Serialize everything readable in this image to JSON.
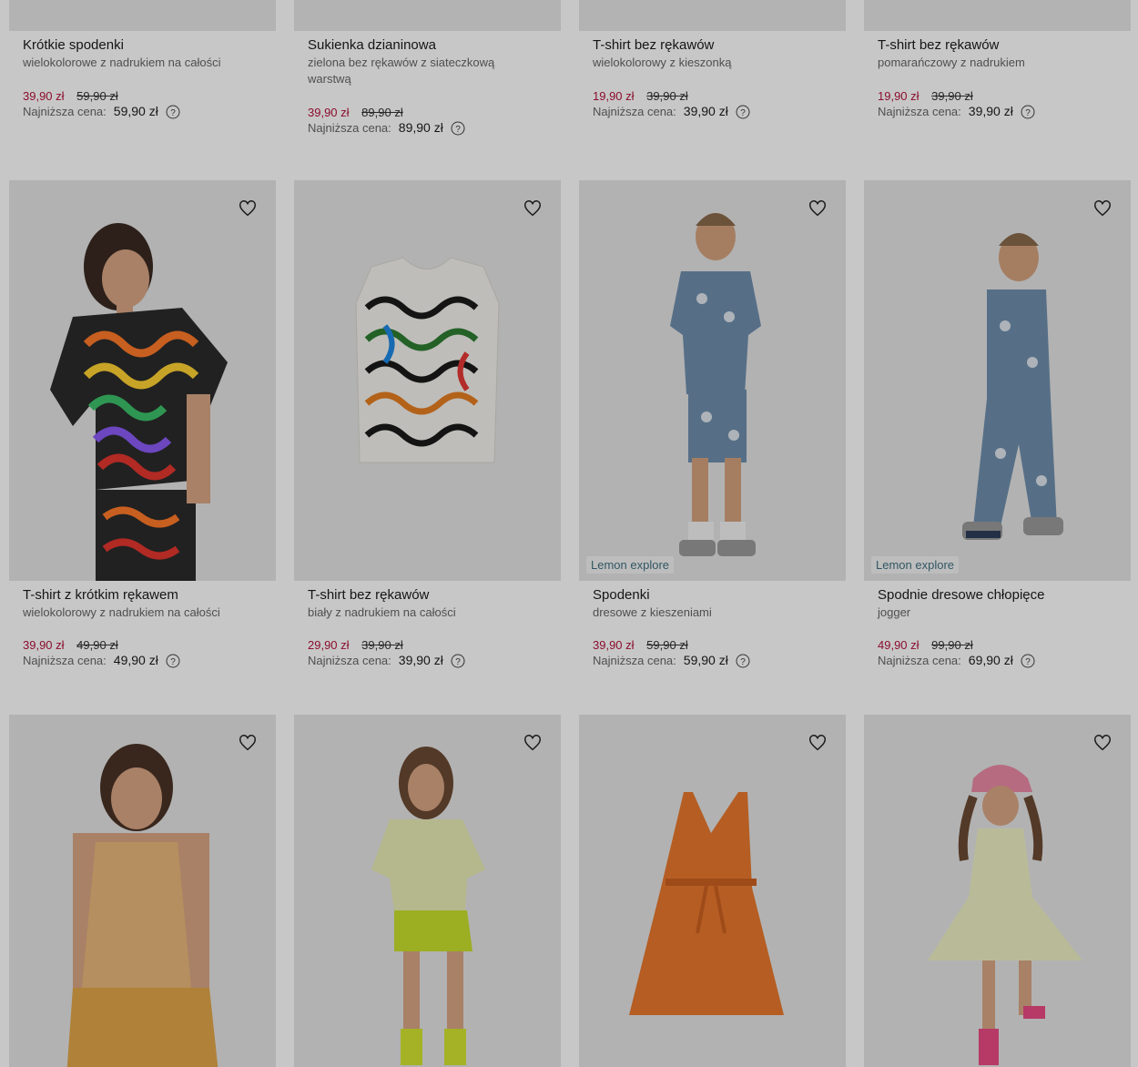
{
  "currency_note": "",
  "lowest_label": "Najniższa cena:",
  "rows": [
    {
      "products": [
        {
          "name": "Krótkie spodenki",
          "desc": "wielokolorowe z nadrukiem na całości",
          "price_new": "39,90 zł",
          "price_old": "59,90 zł",
          "lowest": "59,90 zł"
        },
        {
          "name": "Sukienka dzianinowa",
          "desc": "zielona bez rękawów z siateczkową warstwą",
          "price_new": "39,90 zł",
          "price_old": "89,90 zł",
          "lowest": "89,90 zł"
        },
        {
          "name": "T-shirt bez rękawów",
          "desc": "wielokolorowy z kieszonką",
          "price_new": "19,90 zł",
          "price_old": "39,90 zł",
          "lowest": "39,90 zł"
        },
        {
          "name": "T-shirt bez rękawów",
          "desc": "pomarańczowy z nadrukiem",
          "price_new": "19,90 zł",
          "price_old": "39,90 zł",
          "lowest": "39,90 zł"
        }
      ]
    },
    {
      "products": [
        {
          "name": "T-shirt z krótkim rękawem",
          "desc": "wielokolorowy z nadrukiem na całości",
          "price_new": "39,90 zł",
          "price_old": "49,90 zł",
          "lowest": "49,90 zł",
          "badge": ""
        },
        {
          "name": "T-shirt bez rękawów",
          "desc": "biały z nadrukiem na całości",
          "price_new": "29,90 zł",
          "price_old": "39,90 zł",
          "lowest": "39,90 zł",
          "badge": ""
        },
        {
          "name": "Spodenki",
          "desc": "dresowe z kieszeniami",
          "price_new": "39,90 zł",
          "price_old": "59,90 zł",
          "lowest": "59,90 zł",
          "badge": "Lemon explore"
        },
        {
          "name": "Spodnie dresowe chłopięce",
          "desc": "jogger",
          "price_new": "49,90 zł",
          "price_old": "99,90 zł",
          "lowest": "69,90 zł",
          "badge": "Lemon explore"
        }
      ]
    }
  ],
  "colors": {
    "sale_price": "#b3123a",
    "badge_text": "#3f6f7f",
    "tile_bg": "#e6e6e6"
  },
  "icons": {
    "favorite": "heart-icon",
    "help": "question-circle-icon"
  }
}
